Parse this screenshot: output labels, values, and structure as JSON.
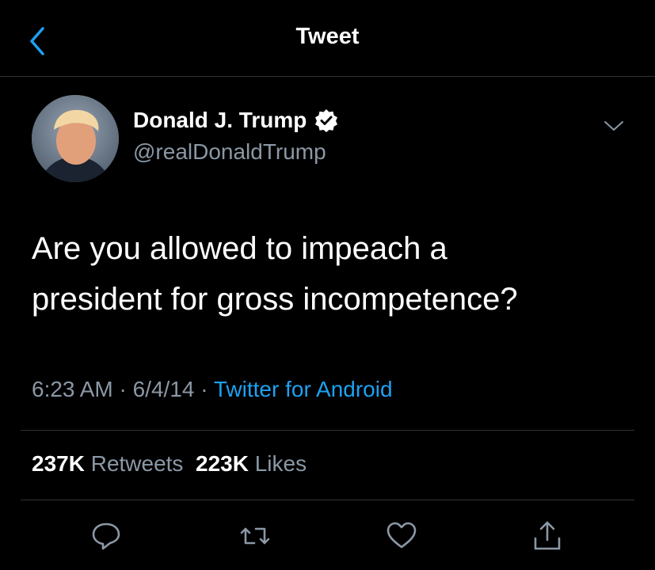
{
  "header": {
    "title": "Tweet",
    "back_icon": "chevron-left-icon",
    "accent": "#1da1f2"
  },
  "author": {
    "name": "Donald J. Trump",
    "handle": "@realDonaldTrump",
    "verified_icon": "verified-badge-icon"
  },
  "tweet": {
    "lines": [
      "Are you allowed to impeach a",
      "president for gross incompetence?"
    ],
    "time": "6:23 AM",
    "date": "6/4/14",
    "source": "Twitter for Android"
  },
  "stats": {
    "retweets": "237K",
    "retweets_label": "Retweets",
    "likes": "223K",
    "likes_label": "Likes"
  },
  "actions": [
    "reply-icon",
    "retweet-icon",
    "like-icon",
    "share-icon"
  ]
}
